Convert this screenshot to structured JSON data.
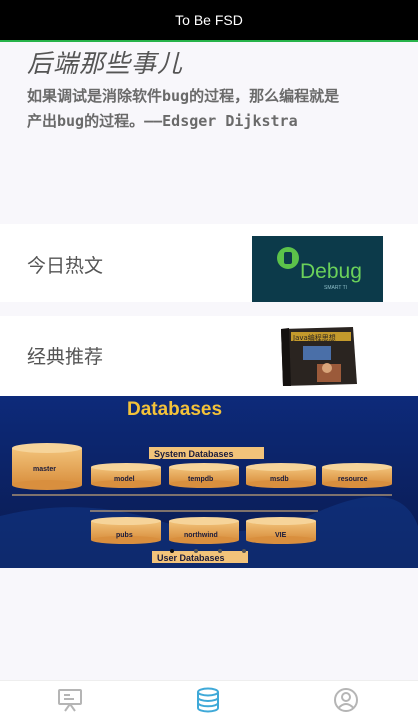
{
  "app": {
    "title": "To Be FSD"
  },
  "hero": {
    "title": "后端那些事儿",
    "quote_line1": "如果调试是消除软件bug的过程，那么编程就是",
    "quote_line2": "产出bug的过程。——Edsger Dijkstra"
  },
  "sections": {
    "hot": {
      "label": "今日热文",
      "thumb_text": "Debug",
      "thumb_sub": "SMART TI"
    },
    "classic": {
      "label": "经典推荐",
      "thumb_text": "Java编程思想"
    }
  },
  "banner": {
    "heading": "Databases",
    "system_label": "System Databases",
    "user_label": "User Databases",
    "system_dbs": [
      "master",
      "model",
      "tempdb",
      "msdb",
      "resource"
    ],
    "user_dbs": [
      "pubs",
      "northwind",
      "VIE"
    ]
  },
  "tabs": [
    {
      "name": "articles",
      "icon": "presentation-icon",
      "active": false
    },
    {
      "name": "database",
      "icon": "database-icon",
      "active": true
    },
    {
      "name": "profile",
      "icon": "user-icon",
      "active": false
    }
  ],
  "colors": {
    "accent": "#27b34a",
    "tab_active": "#3fa9d8",
    "tab_inactive": "#b5b5b5"
  }
}
